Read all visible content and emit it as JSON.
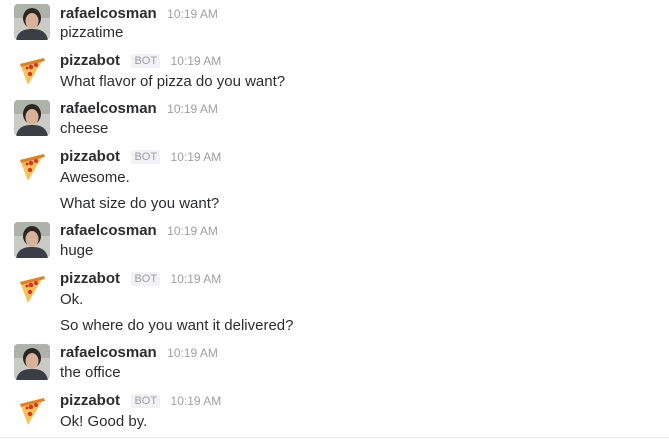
{
  "messages": [
    {
      "user": "rafaelcosman",
      "bot": false,
      "time": "10:19 AM",
      "lines": [
        "pizzatime"
      ]
    },
    {
      "user": "pizzabot",
      "bot": true,
      "badge": "BOT",
      "time": "10:19 AM",
      "lines": [
        "What flavor of pizza do you want?"
      ]
    },
    {
      "user": "rafaelcosman",
      "bot": false,
      "time": "10:19 AM",
      "lines": [
        "cheese"
      ]
    },
    {
      "user": "pizzabot",
      "bot": true,
      "badge": "BOT",
      "time": "10:19 AM",
      "lines": [
        "Awesome.",
        "What size do you want?"
      ]
    },
    {
      "user": "rafaelcosman",
      "bot": false,
      "time": "10:19 AM",
      "lines": [
        "huge"
      ]
    },
    {
      "user": "pizzabot",
      "bot": true,
      "badge": "BOT",
      "time": "10:19 AM",
      "lines": [
        "Ok.",
        "So where do you want it delivered?"
      ]
    },
    {
      "user": "rafaelcosman",
      "bot": false,
      "time": "10:19 AM",
      "lines": [
        "the office"
      ]
    },
    {
      "user": "pizzabot",
      "bot": true,
      "badge": "BOT",
      "time": "10:19 AM",
      "lines": [
        "Ok! Good by."
      ]
    }
  ]
}
